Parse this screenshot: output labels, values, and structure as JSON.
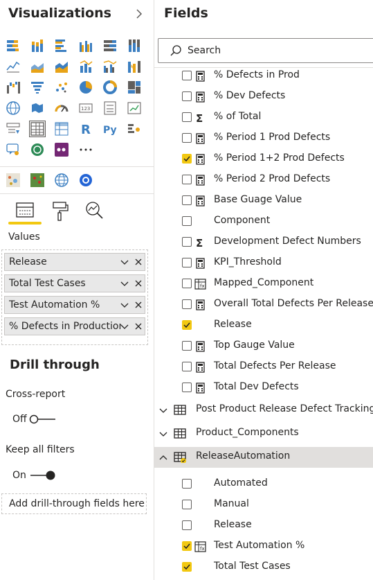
{
  "viz_pane": {
    "title": "Visualizations",
    "gallery_icons": [
      "stacked-bar-chart-icon",
      "stacked-column-chart-icon",
      "clustered-bar-chart-icon",
      "clustered-column-chart-icon",
      "100-stacked-bar-chart-icon",
      "100-stacked-column-chart-icon",
      "line-chart-icon",
      "area-chart-icon",
      "stacked-area-chart-icon",
      "line-and-stacked-column-chart-icon",
      "line-and-clustered-column-chart-icon",
      "ribbon-chart-icon",
      "waterfall-chart-icon",
      "funnel-chart-icon",
      "scatter-chart-icon",
      "pie-chart-icon",
      "donut-chart-icon",
      "treemap-icon",
      "map-icon",
      "filled-map-icon",
      "gauge-icon",
      "card-icon",
      "multi-row-card-icon",
      "kpi-icon",
      "slicer-icon",
      "table-icon",
      "matrix-icon",
      "r-script-visual-icon",
      "python-visual-icon",
      "key-influencers-icon",
      "qa-visual-icon",
      "arcgis-map-icon",
      "power-apps-icon",
      "more-visuals-icon"
    ],
    "custom_icons": [
      "custom-visual-heatmap-icon",
      "custom-visual-map-icon",
      "custom-visual-globe-icon",
      "custom-visual-circle-icon"
    ],
    "tabs": [
      "fields-tab",
      "format-tab",
      "analytics-tab"
    ],
    "values_label": "Values",
    "value_wells": [
      {
        "label": "Release"
      },
      {
        "label": "Total Test Cases"
      },
      {
        "label": "Test Automation %"
      },
      {
        "label": "% Defects in Production"
      }
    ],
    "drill_through": {
      "title": "Drill through",
      "cross_report_label": "Cross-report",
      "cross_report_state": "Off",
      "keep_filters_label": "Keep all filters",
      "keep_filters_state": "On",
      "add_fields_placeholder": "Add drill-through fields here"
    }
  },
  "fields_pane": {
    "title": "Fields",
    "search_placeholder": "Search",
    "fields": [
      {
        "name": "% Defects in Prod",
        "checked": false,
        "icon": "calculator-icon"
      },
      {
        "name": "% Dev Defects",
        "checked": false,
        "icon": "calculator-icon"
      },
      {
        "name": "% of Total",
        "checked": false,
        "icon": "sigma-icon"
      },
      {
        "name": "% Period 1 Prod Defects",
        "checked": false,
        "icon": "calculator-icon"
      },
      {
        "name": "% Period 1+2 Prod Defects",
        "checked": true,
        "icon": "calculator-icon"
      },
      {
        "name": "% Period 2 Prod Defects",
        "checked": false,
        "icon": "calculator-icon"
      },
      {
        "name": "Base Guage Value",
        "checked": false,
        "icon": "calculator-icon"
      },
      {
        "name": "Component",
        "checked": false,
        "icon": ""
      },
      {
        "name": "Development Defect Numbers",
        "checked": false,
        "icon": "sigma-icon"
      },
      {
        "name": "KPI_Threshold",
        "checked": false,
        "icon": "calculator-icon"
      },
      {
        "name": "Mapped_Component",
        "checked": false,
        "icon": "calculated-column-icon"
      },
      {
        "name": "Overall Total Defects Per Release",
        "checked": false,
        "icon": "calculator-icon"
      },
      {
        "name": "Release",
        "checked": true,
        "icon": ""
      },
      {
        "name": "Top Gauge Value",
        "checked": false,
        "icon": "calculator-icon"
      },
      {
        "name": "Total Defects Per Release",
        "checked": false,
        "icon": "calculator-icon"
      },
      {
        "name": "Total Dev Defects",
        "checked": false,
        "icon": "calculator-icon"
      }
    ],
    "tables": [
      {
        "name": "Post Product Release Defect Tracking",
        "expanded": false,
        "selected": false
      },
      {
        "name": "Product_Components",
        "expanded": false,
        "selected": false
      },
      {
        "name": "ReleaseAutomation",
        "expanded": true,
        "selected": true
      }
    ],
    "release_automation_fields": [
      {
        "name": "Automated",
        "checked": false,
        "icon": ""
      },
      {
        "name": "Manual",
        "checked": false,
        "icon": ""
      },
      {
        "name": "Release",
        "checked": false,
        "icon": ""
      },
      {
        "name": "Test Automation %",
        "checked": true,
        "icon": "calculated-column-icon"
      },
      {
        "name": "Total Test Cases",
        "checked": true,
        "icon": ""
      }
    ]
  },
  "colors": {
    "accent": "#f2c811",
    "selected_row": "#e1dfdd",
    "border": "#c8c6c4"
  }
}
